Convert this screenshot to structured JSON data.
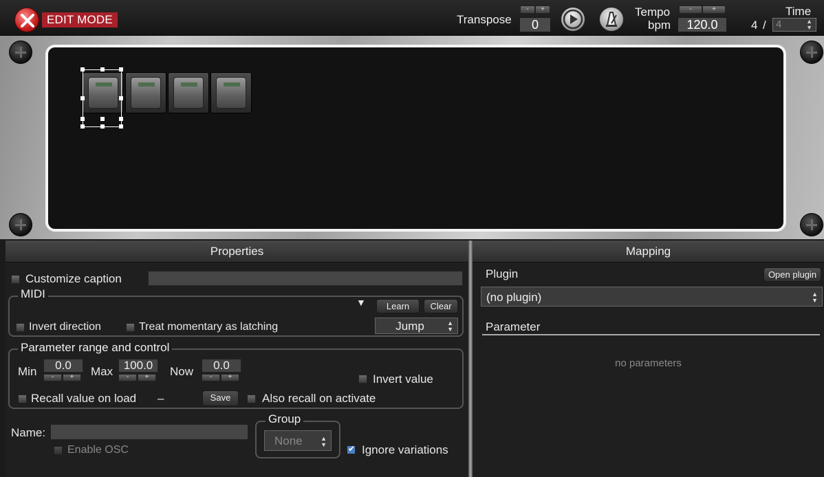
{
  "toolbar": {
    "edit_mode_label": "EDIT MODE",
    "transpose_label": "Transpose",
    "transpose_value": "0",
    "minus": "-",
    "plus": "+",
    "tempo_label": "Tempo",
    "bpm_label": "bpm",
    "tempo_value": "120.0",
    "time_label": "Time",
    "time_numerator": "4",
    "time_slash": "/",
    "time_denominator": "4"
  },
  "rack": {
    "pad_count": 4,
    "selected_pad": 1
  },
  "properties": {
    "header": "Properties",
    "customize_caption": "Customize caption",
    "midi": {
      "title": "MIDI",
      "learn": "Learn",
      "clear": "Clear",
      "invert_direction": "Invert direction",
      "treat_momentary": "Treat momentary as latching",
      "mode": "Jump"
    },
    "range": {
      "title": "Parameter range and control",
      "min_label": "Min",
      "min_value": "0.0",
      "max_label": "Max",
      "max_value": "100.0",
      "now_label": "Now",
      "now_value": "0.0",
      "invert_value": "Invert value",
      "recall_value": "Recall value on load",
      "recall_dash": "–",
      "save": "Save",
      "also_recall": "Also recall on activate"
    },
    "name_label": "Name:",
    "enable_osc": "Enable OSC",
    "group": {
      "title": "Group",
      "value": "None"
    },
    "ignore_variations": "Ignore variations"
  },
  "mapping": {
    "header": "Mapping",
    "plugin_label": "Plugin",
    "open_plugin": "Open plugin",
    "plugin_value": "(no plugin)",
    "parameter_label": "Parameter",
    "empty_text": "no parameters"
  },
  "colors": {
    "edit_badge": "#a8202a",
    "checkbox_checked": "#4a80c0"
  }
}
